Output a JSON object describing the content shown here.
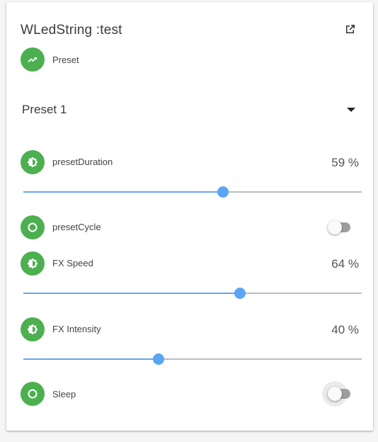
{
  "card": {
    "title": "WLedString :test",
    "open_icon": "open-in-new-icon"
  },
  "preset": {
    "icon": "trending-up-icon",
    "label": "Preset",
    "selected": "Preset 1"
  },
  "controls": [
    {
      "type": "slider",
      "icon": "brightness-icon",
      "label": "presetDuration",
      "value_text": "59 %",
      "level": 0.59
    },
    {
      "type": "switch",
      "icon": "circle-outline-icon",
      "label": "presetCycle",
      "on": false
    },
    {
      "type": "slider",
      "icon": "brightness-icon",
      "label": "FX Speed",
      "value_text": "64 %",
      "level": 0.64
    },
    {
      "type": "slider",
      "icon": "brightness-icon",
      "label": "FX Intensity",
      "value_text": "40 %",
      "level": 0.4
    },
    {
      "type": "switch",
      "icon": "circle-outline-icon",
      "label": "Sleep",
      "on": false
    }
  ],
  "colors": {
    "icon_circle": "#4caf50",
    "slider_accent": "#5aa6f5",
    "track": "#bdbdbd",
    "switch_off_track": "#9e9e9e"
  }
}
